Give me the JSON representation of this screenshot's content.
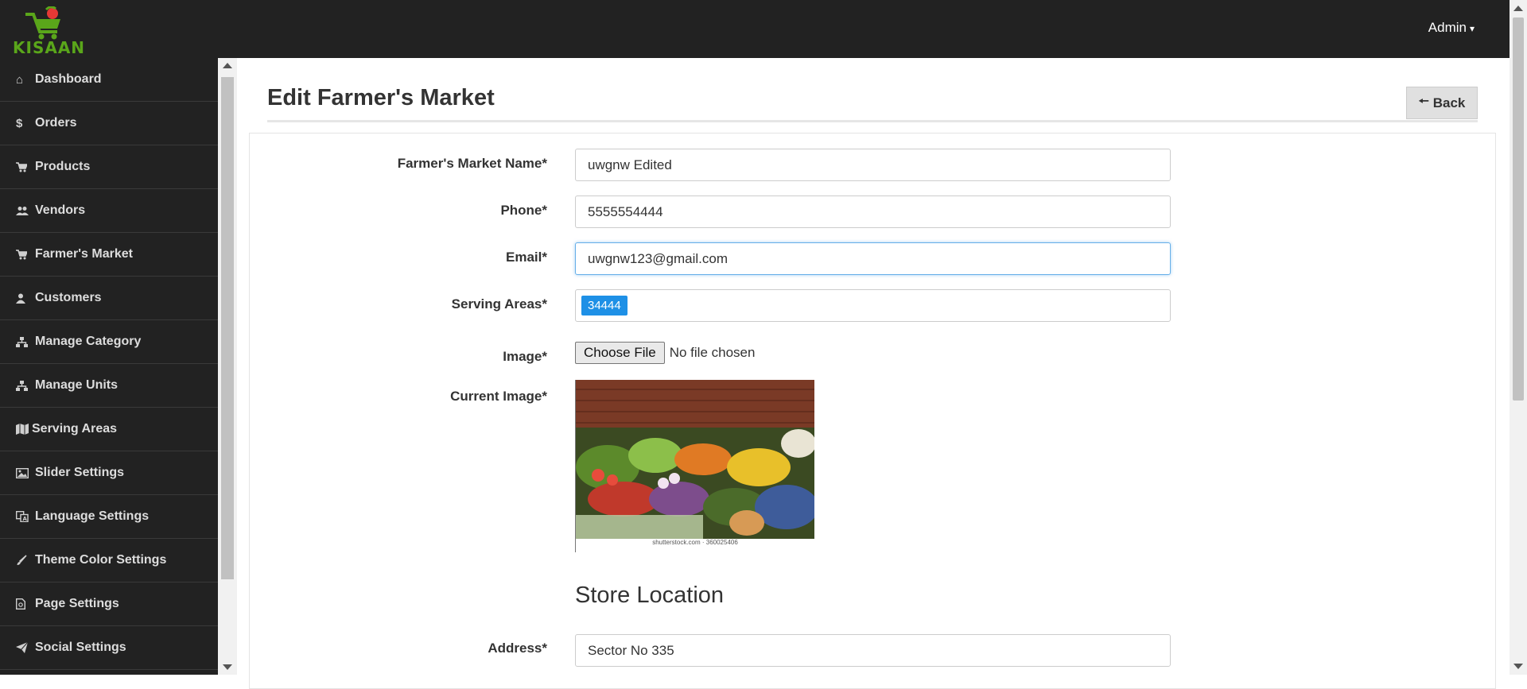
{
  "app": {
    "brand": "KISAAN",
    "user_menu": "Admin"
  },
  "sidebar": {
    "items": [
      {
        "label": "Dashboard",
        "icon": "home-icon"
      },
      {
        "label": "Orders",
        "icon": "dollar-icon"
      },
      {
        "label": "Products",
        "icon": "cart-icon"
      },
      {
        "label": "Vendors",
        "icon": "users-icon"
      },
      {
        "label": "Farmer's Market",
        "icon": "cart-icon"
      },
      {
        "label": "Customers",
        "icon": "user-icon"
      },
      {
        "label": "Manage Category",
        "icon": "sitemap-icon"
      },
      {
        "label": "Manage Units",
        "icon": "sitemap-icon"
      },
      {
        "label": "Serving Areas",
        "icon": "map-icon"
      },
      {
        "label": "Slider Settings",
        "icon": "image-icon"
      },
      {
        "label": "Language Settings",
        "icon": "language-icon"
      },
      {
        "label": "Theme Color Settings",
        "icon": "brush-icon"
      },
      {
        "label": "Page Settings",
        "icon": "page-icon"
      },
      {
        "label": "Social Settings",
        "icon": "send-icon"
      }
    ]
  },
  "page": {
    "title": "Edit Farmer's Market",
    "back_label": "Back"
  },
  "form": {
    "name_label": "Farmer's Market Name*",
    "name_value": "uwgnw Edited",
    "phone_label": "Phone*",
    "phone_value": "5555554444",
    "email_label": "Email*",
    "email_value": "uwgnw123@gmail.com",
    "areas_label": "Serving Areas*",
    "areas_tags": [
      "34444"
    ],
    "image_label": "Image*",
    "choose_file_label": "Choose File",
    "no_file_text": "No file chosen",
    "current_image_label": "Current Image*",
    "current_image_credit": "shutterstock.com · 360025406",
    "store_location_heading": "Store Location",
    "address_label": "Address*",
    "address_value": "Sector No 335"
  },
  "colors": {
    "topbar": "#222222",
    "sidebar": "#222222",
    "brand_green": "#5aa61a",
    "tag_blue": "#1e90e6"
  }
}
